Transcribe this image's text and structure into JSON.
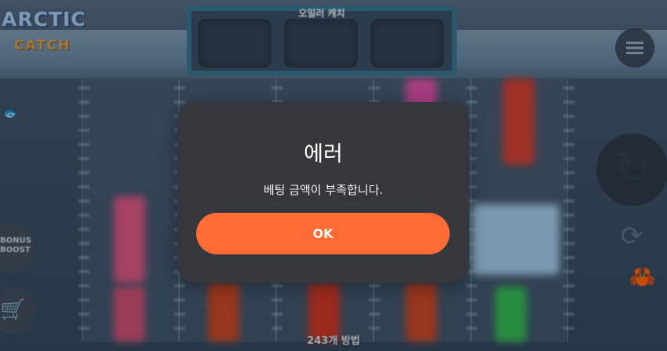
{
  "game": {
    "logo_line1": "ARCTIC",
    "logo_line2": "CATCH",
    "top_title": "오일러 캐치",
    "ways_text": "243개 방법",
    "bonus_label": "BONUS BOOST",
    "icons": [
      "menu-icon",
      "spin-icon",
      "autoplay-icon",
      "cart-icon",
      "crab-icon",
      "fish-icon"
    ]
  },
  "dialog": {
    "title": "에러",
    "message": "베팅 금액이 부족합니다.",
    "ok_label": "OK",
    "ok_color": "#ff6b35",
    "background_color": "#35373d"
  }
}
